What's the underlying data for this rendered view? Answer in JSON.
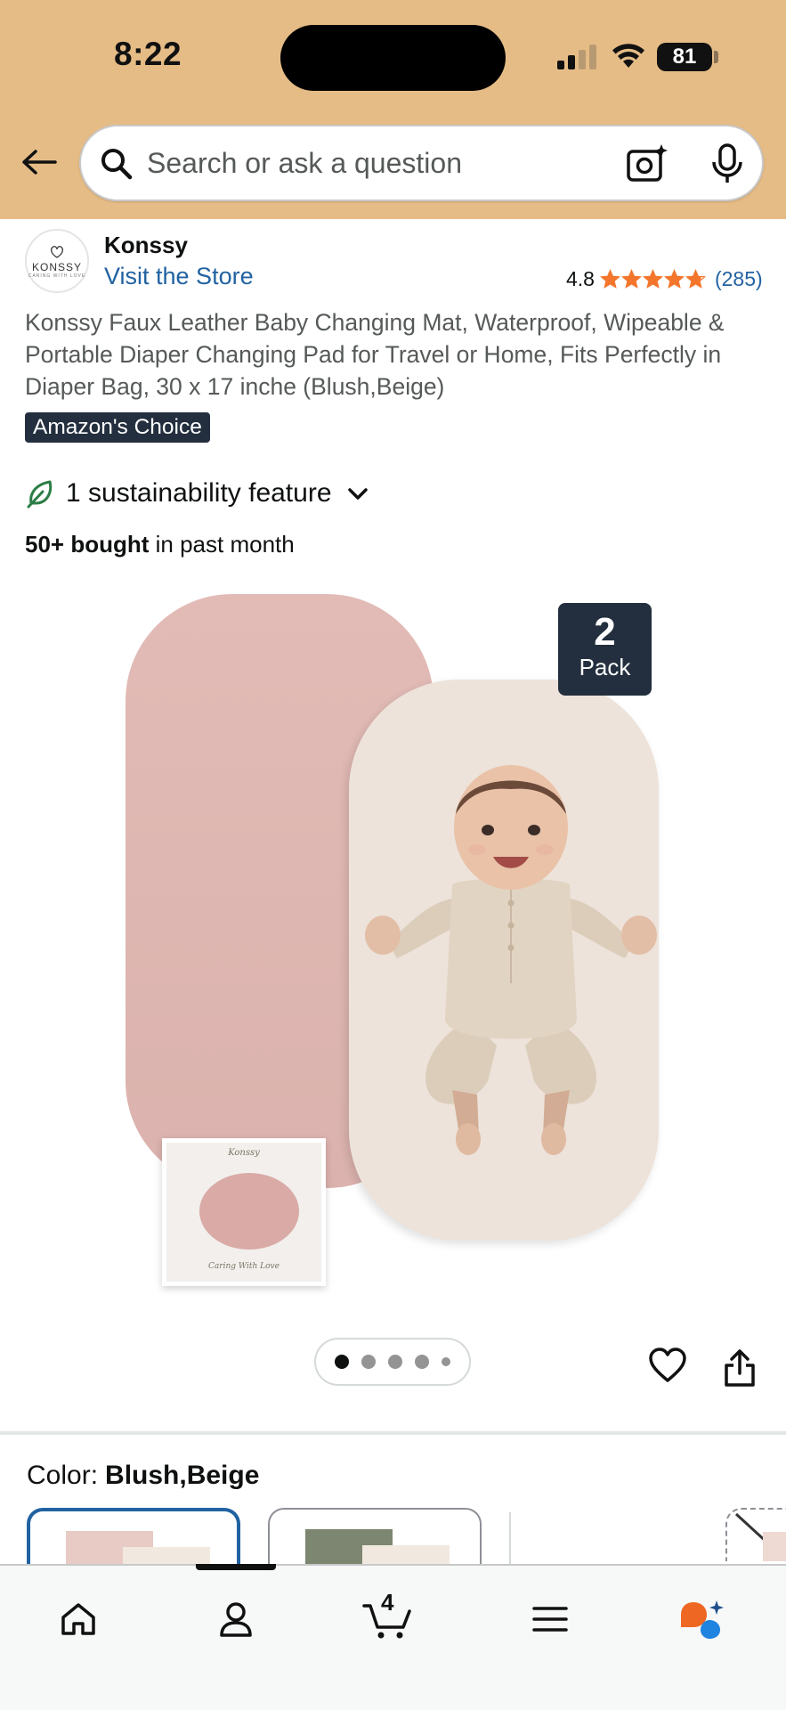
{
  "status_bar": {
    "time": "8:22",
    "battery": "81"
  },
  "search": {
    "placeholder": "Search or ask a question"
  },
  "brand": {
    "logo_text": "KONSSY",
    "logo_sub": "CARING WITH LOVE",
    "name": "Konssy",
    "store_link": "Visit the Store"
  },
  "rating": {
    "value": "4.8",
    "stars": 4.8,
    "count": "(285)",
    "star_color": "#f3762c"
  },
  "product": {
    "title": "Konssy Faux Leather Baby Changing Mat, Waterproof, Wipeable & Portable Diaper Changing Pad for Travel or Home, Fits Perfectly in Diaper Bag, 30 x 17 inche (Blush,Beige)",
    "badge": "Amazon's Choice",
    "sustainability": "1 sustainability feature",
    "bought_bold": "50+ bought",
    "bought_rest": " in past month"
  },
  "image": {
    "pack_number": "2",
    "pack_word": "Pack",
    "box_brand": "Konssy",
    "box_caption": "Caring With Love",
    "carousel": {
      "count": 5,
      "active": 1
    }
  },
  "color": {
    "label": "Color:",
    "selected": "Blush,Beige"
  },
  "swatches": [
    {
      "color": "#e8cbc5",
      "selected": true
    },
    {
      "color": "#7d8670",
      "selected": false
    }
  ],
  "tabbar": {
    "cart_count": "4",
    "active": "home"
  },
  "colors": {
    "header_bg": "#e6bc86",
    "link": "#2162a1",
    "badge_bg": "#232f3e",
    "text": "#0f1111",
    "secondary_text": "#565959",
    "sustain_green": "#2d7d46"
  }
}
